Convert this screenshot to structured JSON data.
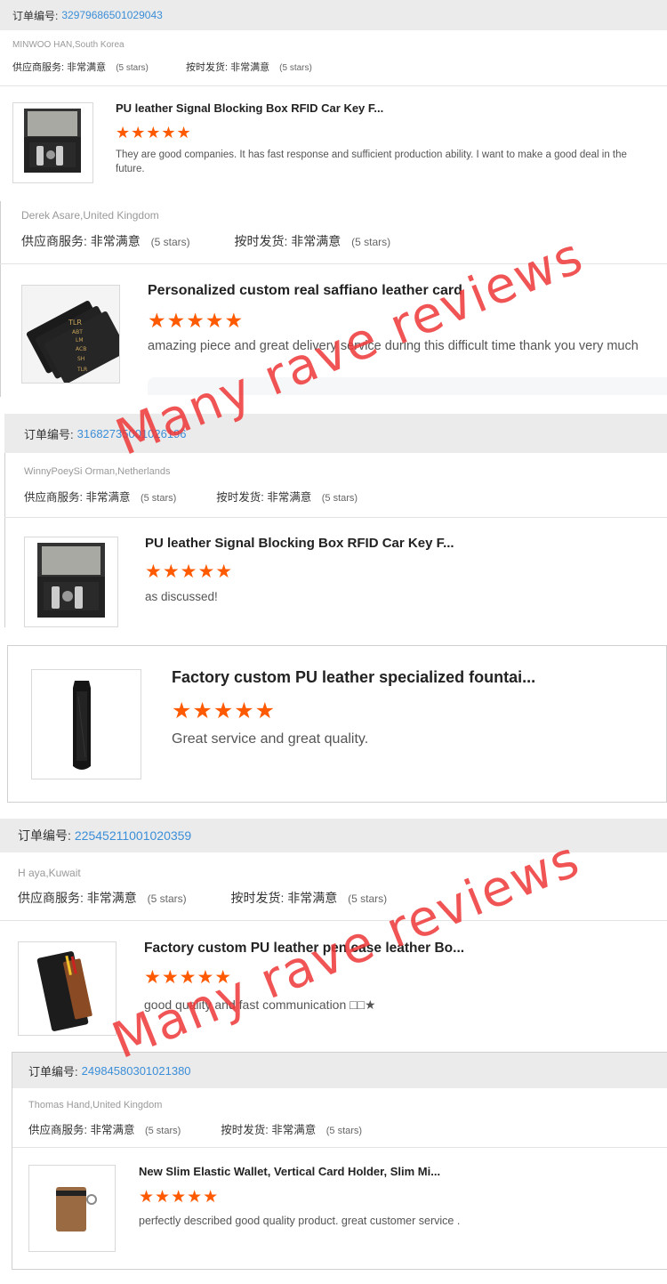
{
  "order_label": "订单编号:",
  "supplier_label": "供应商服务:",
  "ship_label": "按时发货:",
  "rating_value": "非常满意",
  "stars_note": "(5 stars)",
  "star_icons": "★★★★★",
  "reviews": [
    {
      "order_number": "32979686501029043",
      "buyer": "MINWOO HAN,South Korea",
      "product_title": "PU leather Signal Blocking Box RFID Car Key F...",
      "review_text": "They are good companies. It has fast response and sufficient production ability. I want to make a good deal in the future."
    },
    {
      "buyer": "Derek Asare,United Kingdom",
      "product_title": "Personalized custom real saffiano leather card",
      "review_text": "amazing piece and great delivery service during this difficult time thank you very much",
      "card_labels": [
        "TLR",
        "ABT",
        "LM",
        "ACB",
        "SH",
        "TLR"
      ]
    },
    {
      "order_number": "31682735001026196",
      "buyer": "WinnyPoeySi Orman,Netherlands",
      "product_title": "PU leather Signal Blocking Box RFID Car Key F...",
      "review_text": "as discussed!"
    },
    {
      "product_title": "Factory custom PU leather specialized fountai...",
      "review_text": "Great service and great quality."
    },
    {
      "order_number": "22545211001020359",
      "buyer": "H aya,Kuwait",
      "product_title": "Factory custom PU leather pen case leather Bo...",
      "review_text": "good quality and fast communication □□★"
    },
    {
      "order_number": "24984580301021380",
      "buyer": "Thomas Hand,United Kingdom",
      "product_title": "New Slim Elastic Wallet, Vertical Card Holder, Slim Mi...",
      "review_text": "perfectly described good quality product. great customer service ."
    }
  ],
  "watermark_text": "Many rave reviews",
  "colors": {
    "link": "#3b8ed8",
    "star": "#ff5a00",
    "watermark": "#ee3737",
    "bar": "#ebebeb"
  }
}
